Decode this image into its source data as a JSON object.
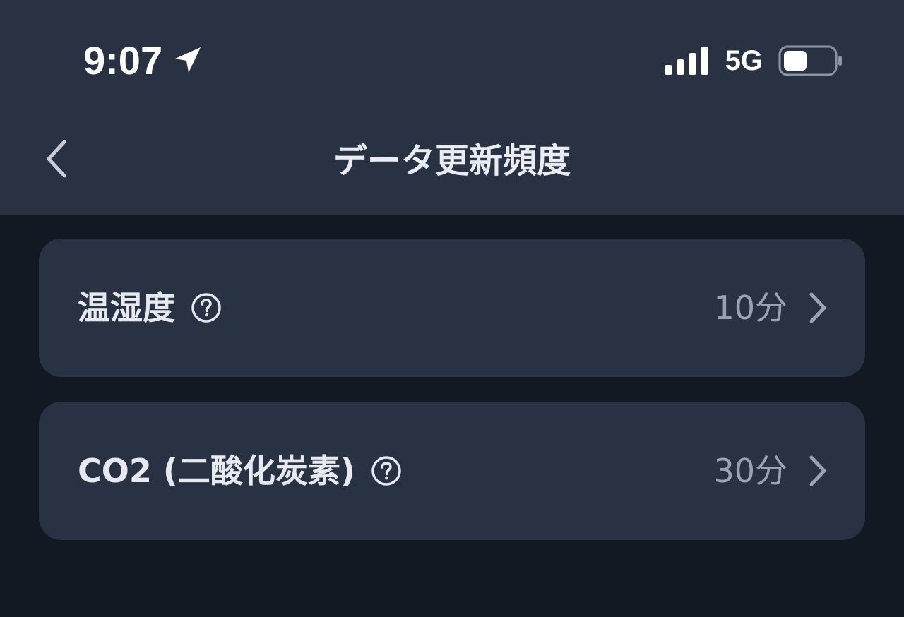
{
  "status_bar": {
    "time": "9:07",
    "network": "5G",
    "icons": [
      "location-arrow-icon",
      "cellular-signal-icon",
      "battery-icon"
    ]
  },
  "nav": {
    "title": "データ更新頻度",
    "back_icon": "chevron-left-icon"
  },
  "settings": {
    "items": [
      {
        "label": "温湿度",
        "value": "10分",
        "help_icon": "question-circle-icon",
        "chevron_icon": "chevron-right-icon"
      },
      {
        "label": "CO2 (二酸化炭素)",
        "value": "30分",
        "help_icon": "question-circle-icon",
        "chevron_icon": "chevron-right-icon"
      }
    ]
  },
  "colors": {
    "header_bg": "#283242",
    "page_bg": "#131923",
    "card_bg": "#283242",
    "primary_text": "#e6e9ee",
    "secondary_text": "#9aa3b1"
  }
}
